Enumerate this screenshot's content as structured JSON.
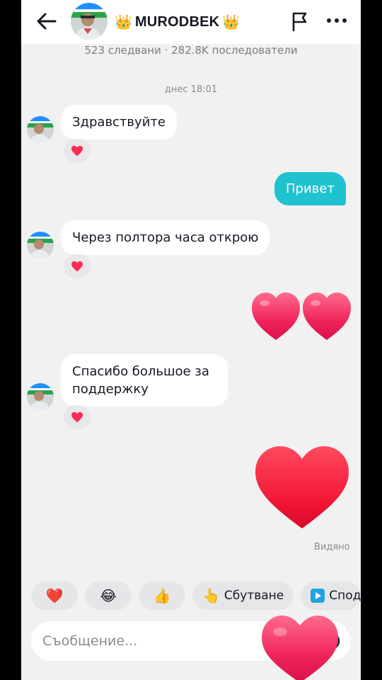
{
  "header": {
    "crown_left": "👑",
    "title": "MURODBEK",
    "crown_right": "👑",
    "stats": "523 следвани · 282.8K последователи"
  },
  "chat": {
    "timestamp": "днес 18:01",
    "messages": [
      {
        "side": "in",
        "text": "Здравствуйте",
        "reaction": "heart"
      },
      {
        "side": "out",
        "text": "Привет"
      },
      {
        "side": "in",
        "text": "Через полтора часа открою",
        "reaction": "heart"
      },
      {
        "side": "out",
        "sticker": "two-hearts"
      },
      {
        "side": "in",
        "text": "Спасибо большое за поддержку",
        "reaction": "heart"
      },
      {
        "side": "out",
        "sticker": "big-heart"
      }
    ],
    "seen_label": "Видяно"
  },
  "quick_replies": {
    "heart": "❤️",
    "laugh": "😂",
    "thumbs": "👍",
    "poke_emoji": "👆",
    "poke_label": "Сбутване",
    "share_label": "Спод"
  },
  "composer": {
    "placeholder": "Съобщение..."
  },
  "colors": {
    "outgoing_bubble": "#20c2cf",
    "heart": "#fe2c55",
    "background": "#f1f1f2"
  }
}
